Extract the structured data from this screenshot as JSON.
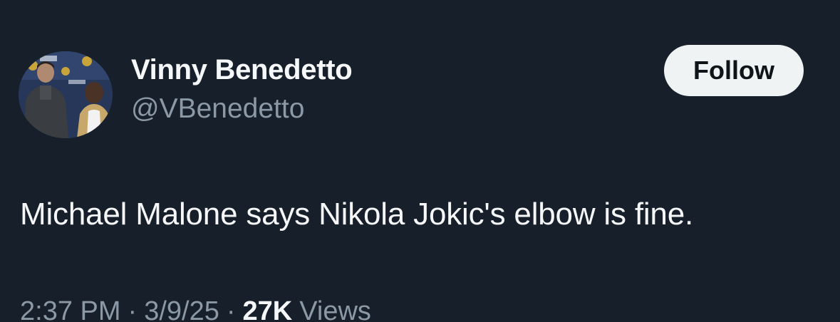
{
  "author": {
    "display_name": "Vinny Benedetto",
    "handle": "@VBenedetto"
  },
  "follow_button": {
    "label": "Follow"
  },
  "tweet": {
    "text": "Michael Malone says Nikola Jokic's elbow is fine."
  },
  "meta": {
    "time": "2:37 PM",
    "separator": "·",
    "date": "3/9/25",
    "views_count": "27K",
    "views_label": "Views"
  },
  "colors": {
    "background": "#171f2a",
    "text_primary": "#f5f7f9",
    "text_secondary": "#8b98a5",
    "button_bg": "#eff3f4",
    "button_text": "#0f1419"
  }
}
